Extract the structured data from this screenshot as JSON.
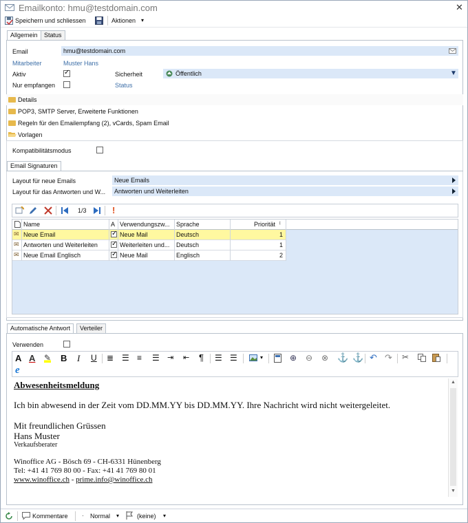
{
  "window": {
    "title": "Emailkonto: hmu@testdomain.com",
    "close": "✕"
  },
  "toolbar": {
    "save_close": "Speichern und schliessen",
    "actions": "Aktionen"
  },
  "tabs_top": {
    "general": "Allgemein",
    "status": "Status"
  },
  "general": {
    "email_label": "Email",
    "email_value": "hmu@testdomain.com",
    "employee_label": "Mitarbeiter",
    "employee_value": "Muster Hans",
    "active_label": "Aktiv",
    "active_checked": true,
    "security_label": "Sicherheit",
    "security_value": "Öffentlich",
    "receive_only_label": "Nur empfangen",
    "receive_only_checked": false,
    "status_label": "Status"
  },
  "sections": {
    "details": "Details",
    "pop3": "POP3, SMTP Server, Erweiterte Funktionen",
    "rules": "Regeln für den Emailempfang (2), vCards, Spam Email",
    "templates": "Vorlagen"
  },
  "compat": {
    "label": "Kompatibilitätsmodus",
    "checked": false
  },
  "signatures": {
    "tab": "Email Signaturen",
    "layout_new_label": "Layout für neue Emails",
    "layout_new_value": "Neue Emails",
    "layout_reply_label": "Layout für das Antworten und W...",
    "layout_reply_value": "Antworten und Weiterleiten",
    "pager": "1/3",
    "columns": [
      "Name",
      "A",
      "Verwendungszw...",
      "Sprache",
      "Priorität"
    ],
    "rows": [
      {
        "name": "Neue Email",
        "a": true,
        "use": "Neue Mail",
        "lang": "Deutsch",
        "prio": "1"
      },
      {
        "name": "Antworten und Weiterleiten",
        "a": true,
        "use": "Weiterleiten und...",
        "lang": "Deutsch",
        "prio": "1"
      },
      {
        "name": "Neue Email Englisch",
        "a": true,
        "use": "Neue Mail",
        "lang": "Englisch",
        "prio": "2"
      }
    ]
  },
  "tabs_bottom": {
    "auto_reply": "Automatische Antwort",
    "distributor": "Verteiler"
  },
  "auto_reply": {
    "use_label": "Verwenden",
    "use_checked": false
  },
  "message": {
    "heading": "Abwesenheitsmeldung",
    "body": "Ich bin abwesend in der Zeit vom DD.MM.YY bis DD.MM.YY. Ihre Nachricht wird nicht weitergeleitet.",
    "greeting": "Mit freundlichen Grüssen",
    "name": "Hans Muster",
    "role": "Verkaufsberater",
    "address": "Winoffice AG - Bösch 69 - CH-6331 Hünenberg",
    "phone": "Tel: +41 41 769 80 00 - Fax: +41 41 769 80 01",
    "web": "www.winoffice.ch",
    "dash": " - ",
    "mail": "prime.info@winoffice.ch"
  },
  "statusbar": {
    "comments": "Kommentare",
    "priority": "Normal",
    "flag": "(keine)"
  },
  "colors": {
    "selected_row": "#fff8a0",
    "field": "#dbe8f8",
    "grid_area": "#dbe8f8"
  }
}
